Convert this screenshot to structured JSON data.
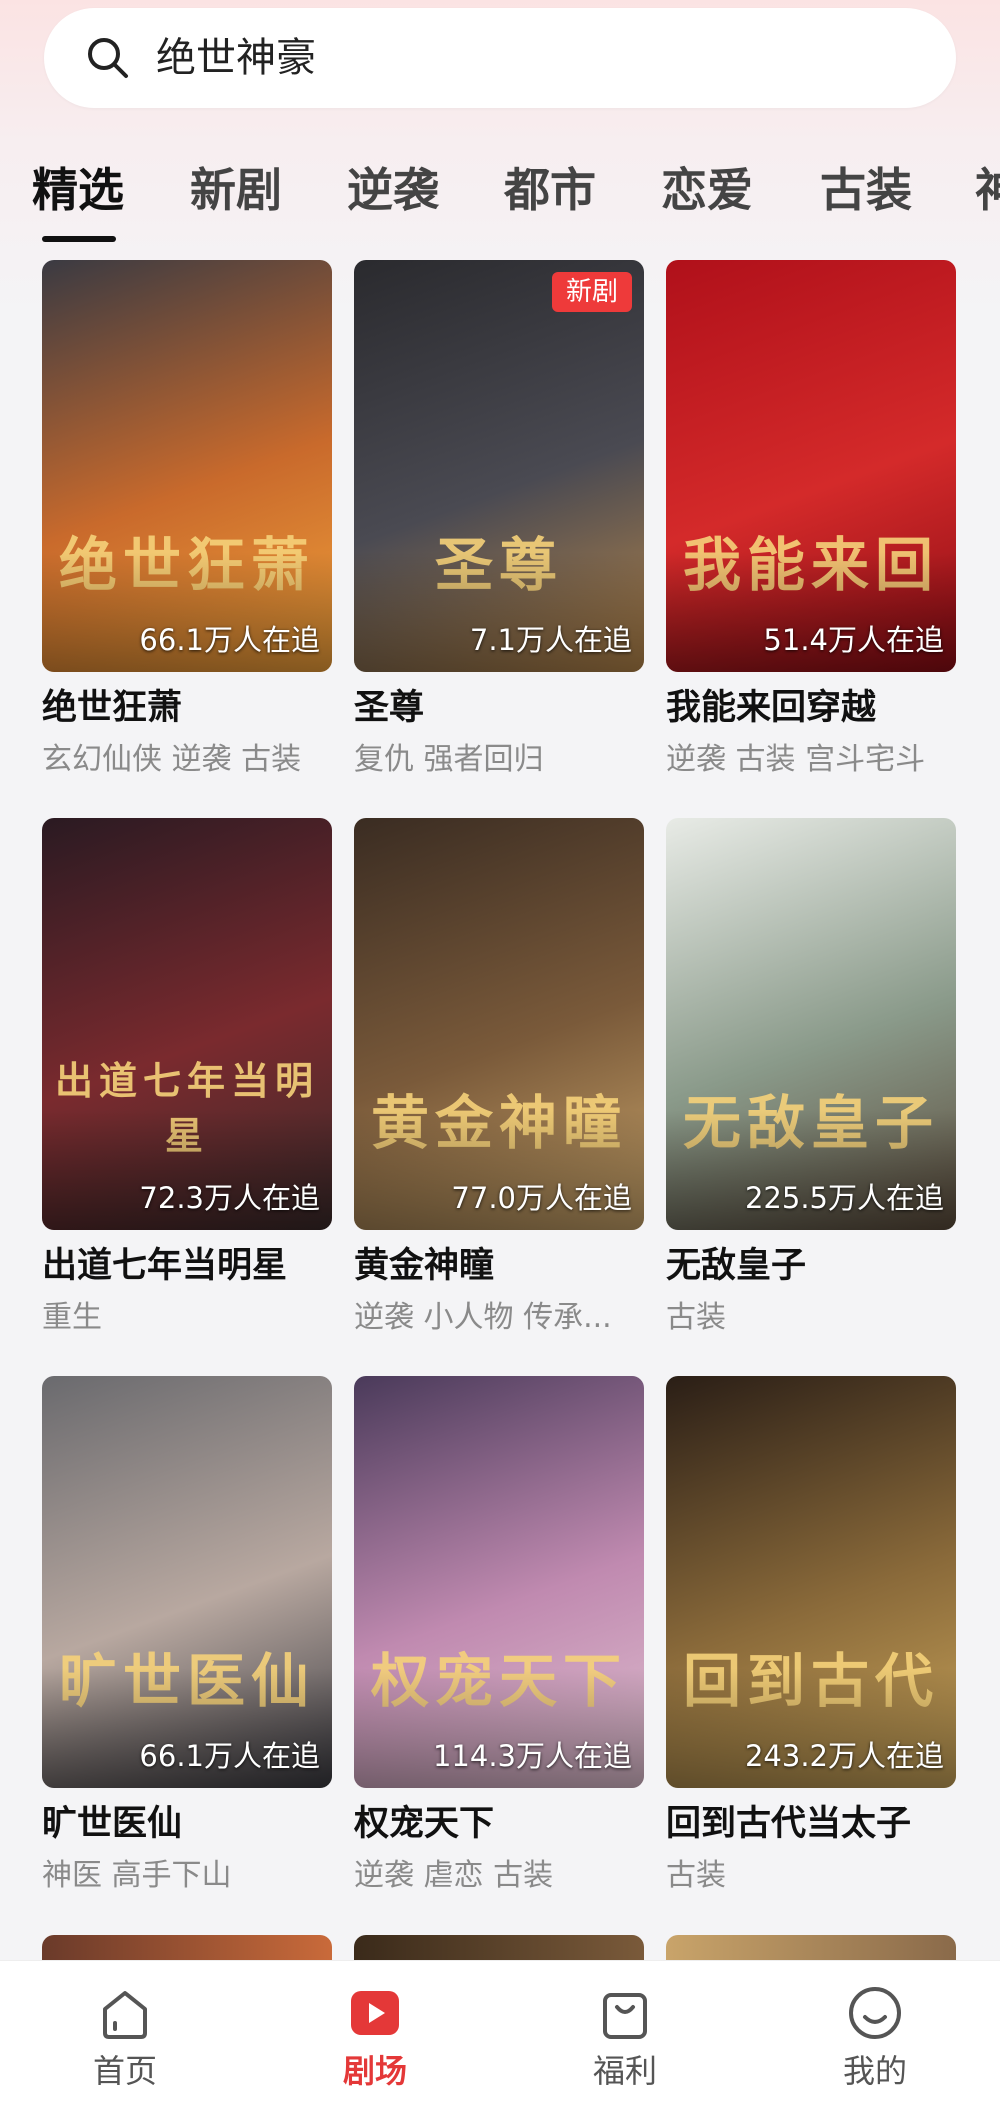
{
  "search": {
    "query": "绝世神豪"
  },
  "tabs": [
    "精选",
    "新剧",
    "逆袭",
    "都市",
    "恋爱",
    "古装",
    "神"
  ],
  "active_tab": "精选",
  "cards": [
    {
      "title": "绝世狂萧",
      "tags": "玄幻仙侠 逆袭 古装",
      "watchers": "66.1万人在追",
      "poster_text": "绝世狂萧",
      "badge": "",
      "colors": [
        "#3a3a42",
        "#c96a2c",
        "#f2a23a"
      ]
    },
    {
      "title": "圣尊",
      "tags": "复仇 强者回归",
      "watchers": "7.1万人在追",
      "poster_text": "圣尊",
      "badge": "新剧",
      "colors": [
        "#2a2a2e",
        "#4a4a52",
        "#b8874a"
      ]
    },
    {
      "title": "我能来回穿越",
      "tags": "逆袭 古装 宫斗宅斗",
      "watchers": "51.4万人在追",
      "poster_text": "我能来回",
      "badge": "",
      "colors": [
        "#b0101a",
        "#d42a2a",
        "#8a0c14"
      ]
    },
    {
      "title": "出道七年当明星",
      "tags": "重生",
      "watchers": "72.3万人在追",
      "poster_text": "出道七年当明星",
      "badge": "",
      "colors": [
        "#2a1a22",
        "#7a2a2e",
        "#3a2a2a"
      ]
    },
    {
      "title": "黄金神瞳",
      "tags": "逆袭 小人物 传承...",
      "watchers": "77.0万人在追",
      "poster_text": "黄金神瞳",
      "badge": "",
      "colors": [
        "#3a2c22",
        "#7a5a3a",
        "#c9a46a"
      ]
    },
    {
      "title": "无敌皇子",
      "tags": "古装",
      "watchers": "225.5万人在追",
      "poster_text": "无敌皇子",
      "badge": "",
      "colors": [
        "#e8ebe6",
        "#8a9a8a",
        "#5a4a3a"
      ]
    },
    {
      "title": "旷世医仙",
      "tags": "神医 高手下山",
      "watchers": "66.1万人在追",
      "poster_text": "旷世医仙",
      "badge": "",
      "colors": [
        "#6a6a6e",
        "#b8a8a0",
        "#3a3a40"
      ]
    },
    {
      "title": "权宠天下",
      "tags": "逆袭 虐恋 古装",
      "watchers": "114.3万人在追",
      "poster_text": "权宠天下",
      "badge": "",
      "colors": [
        "#4a3a5a",
        "#c08ab0",
        "#e0c0d0"
      ]
    },
    {
      "title": "回到古代当太子",
      "tags": "古装",
      "watchers": "243.2万人在追",
      "poster_text": "回到古代",
      "badge": "",
      "colors": [
        "#2a1e16",
        "#8a6a3a",
        "#c9a45a"
      ]
    }
  ],
  "bottom_nav": [
    {
      "label": "首页",
      "icon": "home-icon",
      "active": false
    },
    {
      "label": "剧场",
      "icon": "theater-play-icon",
      "active": true
    },
    {
      "label": "福利",
      "icon": "gift-bag-icon",
      "active": false
    },
    {
      "label": "我的",
      "icon": "profile-smile-icon",
      "active": false
    }
  ],
  "colors": {
    "accent": "#e43838",
    "badge": "#ee3a3a"
  }
}
